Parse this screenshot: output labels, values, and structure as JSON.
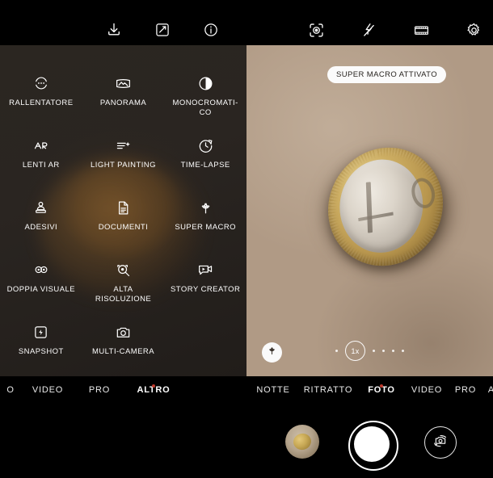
{
  "topbar": {
    "left_icons": [
      {
        "name": "download-icon",
        "label": "Scarica"
      },
      {
        "name": "edit-icon",
        "label": "Modifica"
      },
      {
        "name": "info-icon",
        "label": "Info"
      }
    ],
    "right_icons": [
      {
        "name": "ai-scene-icon",
        "label": "AI Scene"
      },
      {
        "name": "flash-off-icon",
        "label": "Flash off"
      },
      {
        "name": "filmstrip-icon",
        "label": "Filtri"
      },
      {
        "name": "settings-gear-icon",
        "label": "Impostazioni"
      }
    ]
  },
  "mode_grid": {
    "items": [
      {
        "label": "RALLENTATORE",
        "icon": "slow-motion-icon"
      },
      {
        "label": "PANORAMA",
        "icon": "panorama-icon"
      },
      {
        "label": "MONOCROMATI-CO",
        "icon": "monochrome-icon"
      },
      {
        "label": "LENTI AR",
        "icon": "ar-lens-icon"
      },
      {
        "label": "LIGHT PAINTING",
        "icon": "light-painting-icon"
      },
      {
        "label": "TIME-LAPSE",
        "icon": "time-lapse-icon"
      },
      {
        "label": "ADESIVI",
        "icon": "sticker-icon"
      },
      {
        "label": "DOCUMENTI",
        "icon": "document-icon"
      },
      {
        "label": "SUPER MACRO",
        "icon": "flower-macro-icon"
      },
      {
        "label": "DOPPIA VISUALE",
        "icon": "dual-view-icon"
      },
      {
        "label": "ALTA RISOLUZIONE",
        "icon": "high-resolution-icon"
      },
      {
        "label": "STORY CREATOR",
        "icon": "story-creator-icon"
      },
      {
        "label": "SNAPSHOT",
        "icon": "snapshot-icon"
      },
      {
        "label": "MULTI-CAMERA",
        "icon": "multi-camera-icon"
      }
    ]
  },
  "viewfinder": {
    "badge": "SUPER MACRO ATTIVATO",
    "macro_button_icon": "flower-macro-icon",
    "zoom_level": "1x",
    "zoom_dots_left": 1,
    "zoom_dots_right": 4
  },
  "tabbar_left": {
    "tabs": [
      {
        "label": "O",
        "active": false
      },
      {
        "label": "VIDEO",
        "active": false
      },
      {
        "label": "PRO",
        "active": false
      },
      {
        "label": "ALTRO",
        "active": true
      }
    ]
  },
  "tabbar_right": {
    "tabs": [
      {
        "label": "NOTTE",
        "active": false
      },
      {
        "label": "RITRATTO",
        "active": false
      },
      {
        "label": "FOTO",
        "active": true
      },
      {
        "label": "VIDEO",
        "active": false
      },
      {
        "label": "PRO",
        "active": false
      },
      {
        "label": "A",
        "active": false
      }
    ]
  },
  "bottom_controls": {
    "gallery_thumbnail": "gallery-thumbnail",
    "shutter": "shutter-button",
    "flip": "camera-flip-icon"
  },
  "colors": {
    "accent_red": "#c0392b",
    "panel_dark": "#2b2621",
    "viewfinder_bg": "#b09a85",
    "badge_bg": "#fbfbfb"
  }
}
